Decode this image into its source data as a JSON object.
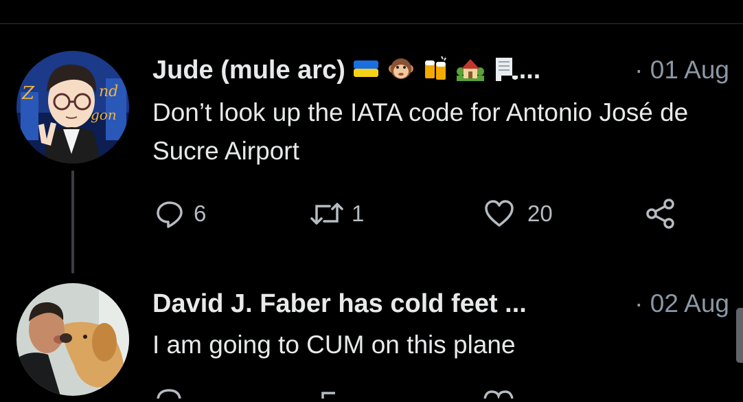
{
  "tweets": [
    {
      "author": "Jude (mule arc)",
      "name_emojis": [
        "ukraine-flag",
        "monkey-face",
        "beer-mugs",
        "house-with-garden",
        "receipt"
      ],
      "truncation": "...",
      "separator": "·",
      "date": "01 Aug",
      "text": "Don’t look up the IATA code for Antonio José de Sucre Airport",
      "replies": "6",
      "retweets": "1",
      "likes": "20"
    },
    {
      "author": "David J. Faber has cold feet ...",
      "separator": "·",
      "date": "02 Aug",
      "text": "I am going to CUM on this plane"
    }
  ],
  "colors": {
    "background": "#000000",
    "text": "#e7e9ea",
    "secondary": "#8b98a5",
    "divider": "#2f3336"
  }
}
